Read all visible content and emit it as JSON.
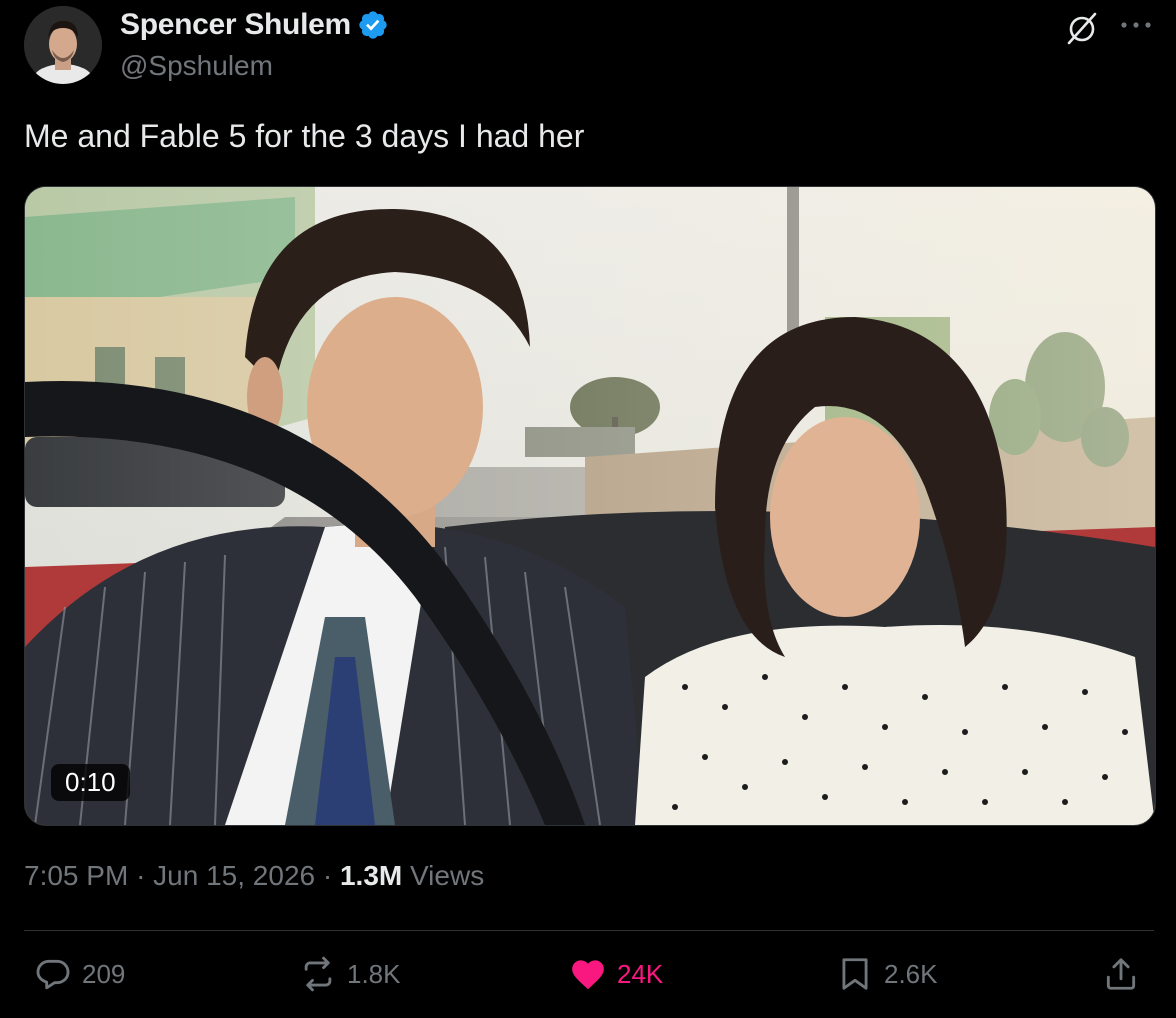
{
  "author": {
    "name": "Spencer Shulem",
    "handle": "@Spshulem",
    "verified": true
  },
  "icons": {
    "verified": "verified-badge-icon",
    "grok": "grok-icon",
    "more": "more-dots-icon",
    "reply": "reply-icon",
    "repost": "repost-icon",
    "like": "heart-icon",
    "bookmark": "bookmark-icon",
    "share": "share-icon"
  },
  "tweet": {
    "text": "Me and Fable 5 for the 3 days I had her"
  },
  "media": {
    "duration": "0:10"
  },
  "meta": {
    "time": "7:05 PM",
    "date": "Jun 15, 2026",
    "views_count": "1.3M",
    "views_label": "Views",
    "separator": "·"
  },
  "actions": {
    "replies": "209",
    "reposts": "1.8K",
    "likes": "24K",
    "bookmarks": "2.6K"
  },
  "colors": {
    "background": "#000000",
    "text": "#e7e9ea",
    "secondary": "#71767b",
    "verified": "#1d9bf0",
    "like": "#f91880",
    "divider": "#2f3336"
  }
}
